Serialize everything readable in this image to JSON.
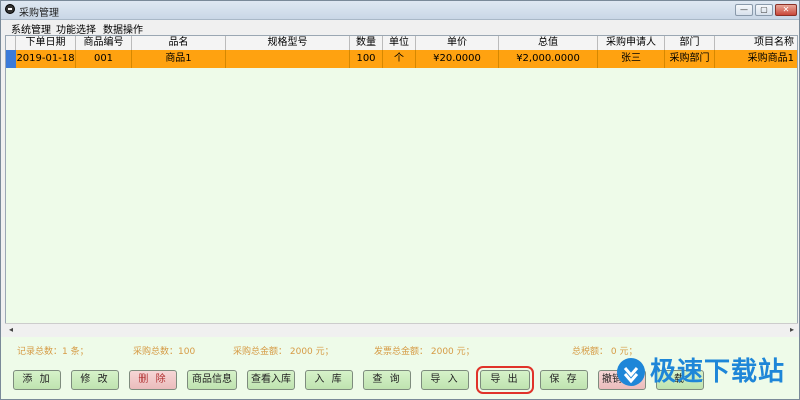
{
  "window": {
    "title": "采购管理"
  },
  "menu": [
    "系统管理",
    "功能选择",
    "数据操作"
  ],
  "table": {
    "columns": [
      "下单日期",
      "商品编号",
      "品名",
      "规格型号",
      "数量",
      "单位",
      "单价",
      "总值",
      "采购申请人",
      "部门",
      "项目名称"
    ],
    "rows": [
      [
        "2019-01-18",
        "001",
        "商品1",
        "",
        "100",
        "个",
        "¥20.0000",
        "¥2,000.0000",
        "张三",
        "采购部门",
        "采购商品1"
      ]
    ]
  },
  "status": {
    "record_total": "记录总数：1 条；",
    "purchase_total": "采购总数：100",
    "purchase_amount": "采购总金额： 2000 元；",
    "invoice_amount": "发票总金额： 2000 元；",
    "tax_amount": "总税额： 0 元；"
  },
  "buttons": {
    "add": "添 加",
    "edit": "修 改",
    "delete": "删 除",
    "product_info": "商品信息",
    "view_stock": "查看入库",
    "stock_in": "入 库",
    "query": "查 询",
    "import": "导 入",
    "export": "导 出",
    "save": "保 存",
    "undo_stock": "撤销入库",
    "load": "载"
  },
  "watermark": {
    "text": "极速下载站"
  },
  "colors": {
    "selected_row": "#ffa210",
    "grid_bg": "#eefbe9",
    "status_text": "#d69b45",
    "watermark": "#1e86d8"
  },
  "icons": [
    "app-icon",
    "minimize-icon",
    "maximize-icon",
    "close-icon",
    "scroll-left-icon",
    "scroll-right-icon",
    "download-logo-icon"
  ]
}
